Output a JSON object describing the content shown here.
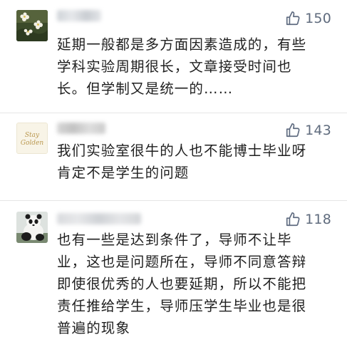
{
  "comments": [
    {
      "avatar": "flowers-avatar",
      "likes": "150",
      "text": "延期一般都是多方面因素造成的，有些\n学科实验周期很长，文章接受时间也\n长。但学制又是统一的……"
    },
    {
      "avatar": "stay-golden-avatar",
      "avatar_text": "Stay Golden",
      "likes": "143",
      "text": "我们实验室很牛的人也不能博士毕业呀\n肯定不是学生的问题"
    },
    {
      "avatar": "panda-avatar",
      "likes": "118",
      "text": "也有一些是达到条件了，导师不让毕\n业，这也是问题所在，导师不同意答辩\n即使很优秀的人也要延期，所以不能把\n责任推给学生，导师压学生毕业也是很\n普遍的现象"
    }
  ],
  "colors": {
    "text": "#1f1f1f",
    "like": "#5f6b7d",
    "divider": "#e6e6e6",
    "background": "#ffffff"
  }
}
